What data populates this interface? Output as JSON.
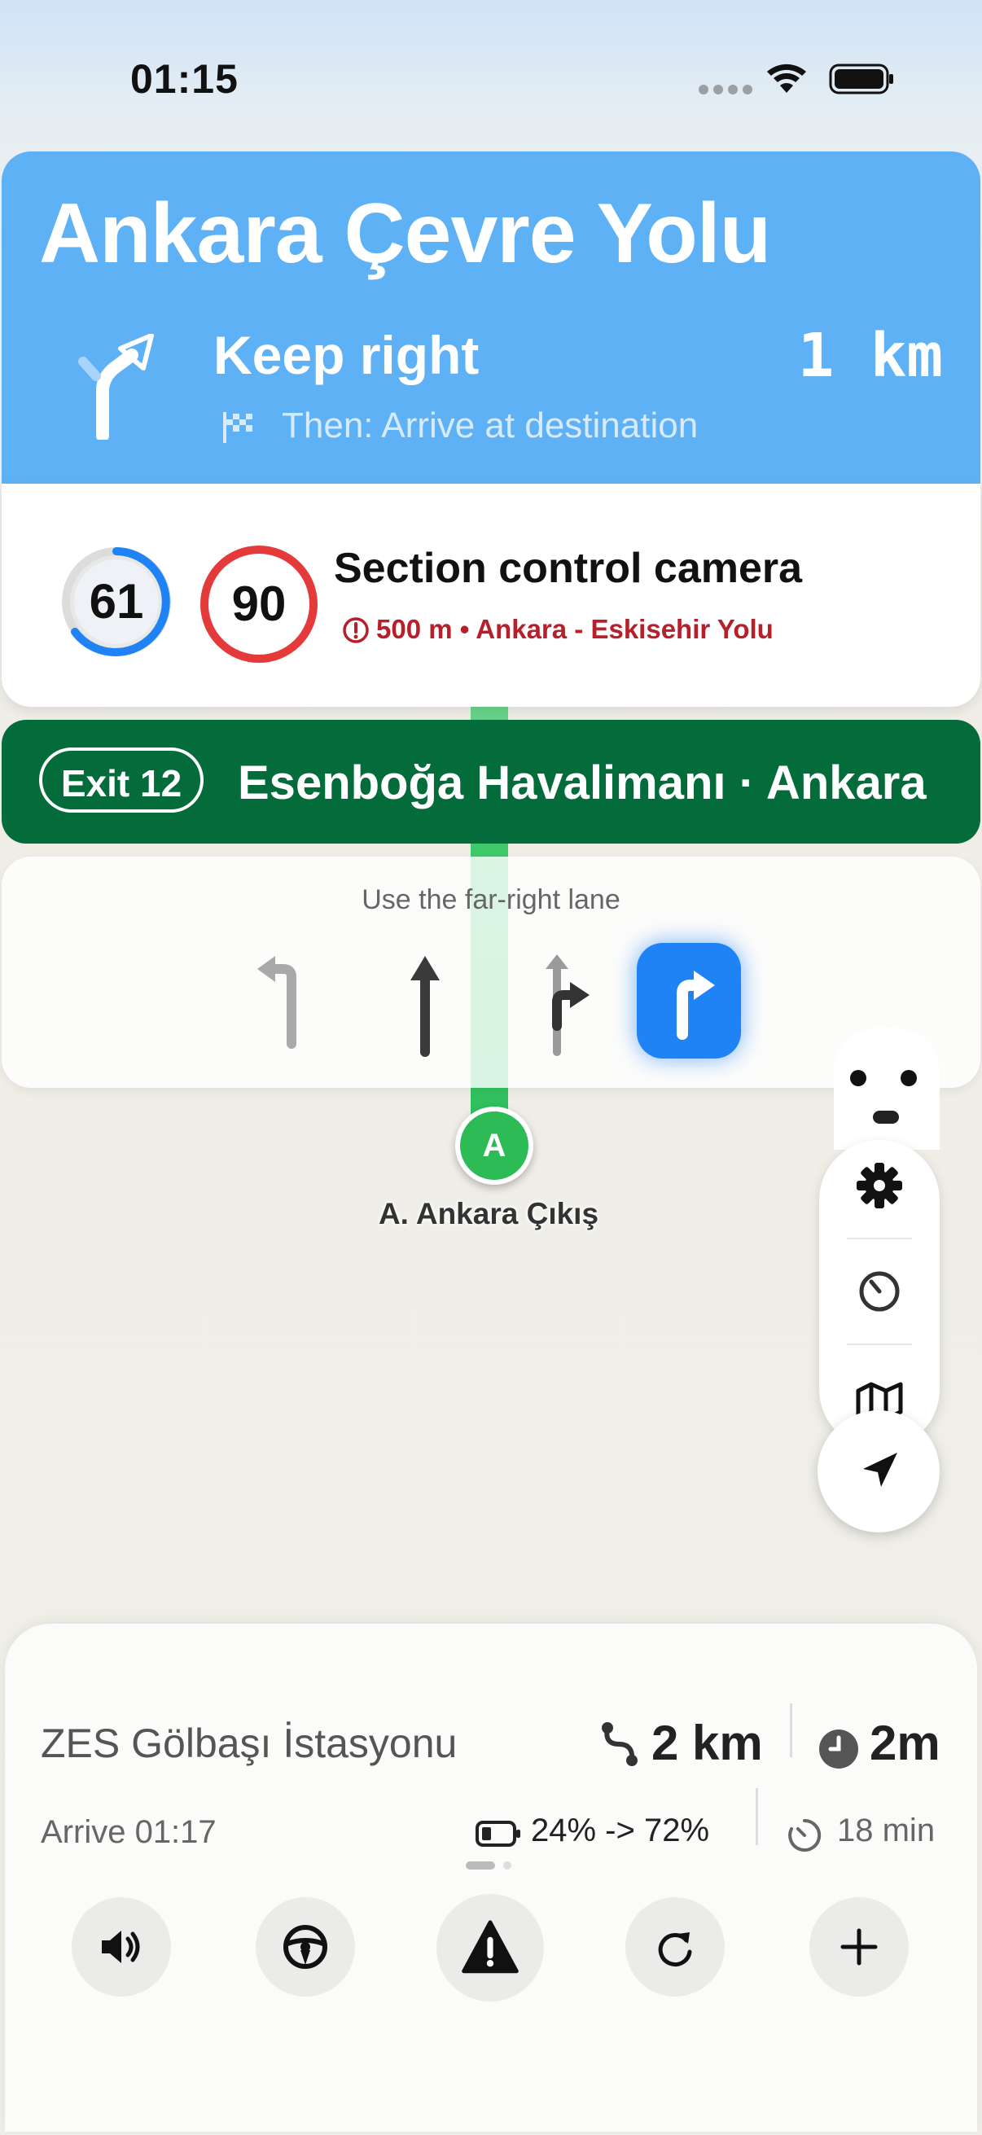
{
  "status_bar": {
    "time": "01:15"
  },
  "header": {
    "street": "Ankara Çevre Yolu",
    "maneuver": "Keep right",
    "distance": "1 km",
    "then": "Then: Arrive at destination",
    "bg_color": "#5fb1f5"
  },
  "camera": {
    "current_speed": "61",
    "speed_limit": "90",
    "title": "Section control camera",
    "subtitle": "500 m • Ankara - Eskisehir Yolu"
  },
  "exit": {
    "badge": "Exit 12",
    "destination": "Esenboğa Havalimanı · Ankara",
    "bg_color": "#046b3a"
  },
  "lanes": {
    "title": "Use the far-right lane",
    "items": [
      "turn-left-lane",
      "straight-lane",
      "straight-right-lane",
      "right-lane-active"
    ]
  },
  "map": {
    "pin_label": "A",
    "place_label": "A. Ankara Çıkış",
    "route_color": "#36c764"
  },
  "side_controls": [
    "gear-icon",
    "gauge-icon",
    "map-icon",
    "location-arrow-icon"
  ],
  "trip": {
    "destination": "ZES Gölbaşı İstasyonu",
    "distance": "2 km",
    "time": "2m",
    "arrive": "Arrive 01:17",
    "charge": "24% -> 72%",
    "charge_time": "18 min"
  },
  "actions": [
    "volume-icon",
    "steering-wheel-icon",
    "warning-icon",
    "reroute-icon",
    "plus-icon"
  ],
  "accent_color": "#1f82f5"
}
